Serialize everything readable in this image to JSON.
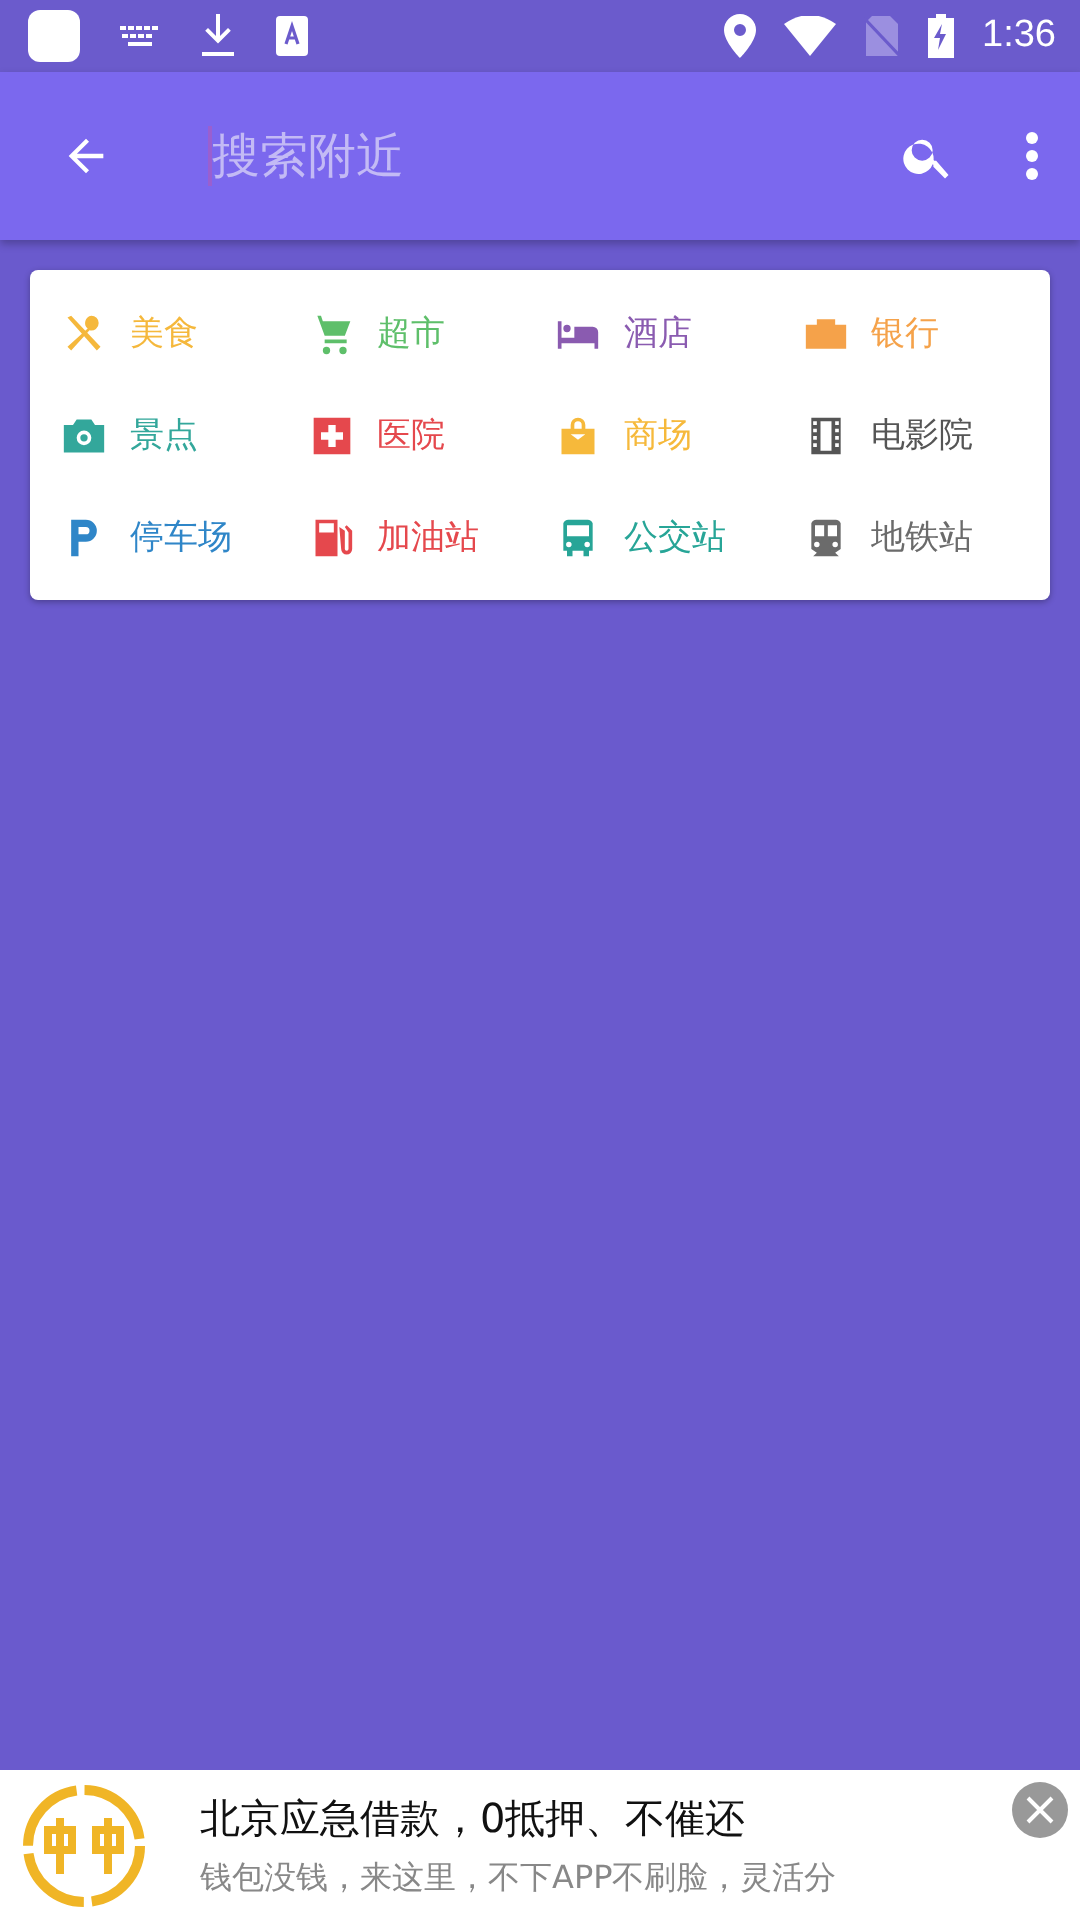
{
  "status_bar": {
    "time": "1:36"
  },
  "toolbar": {
    "search": {
      "placeholder": "搜索附近"
    }
  },
  "categories": [
    {
      "kind": "food",
      "label": "美食",
      "color": "#f5b83c"
    },
    {
      "kind": "cart",
      "label": "超市",
      "color": "#5ebf6a"
    },
    {
      "kind": "bed",
      "label": "酒店",
      "color": "#8a5bb0"
    },
    {
      "kind": "bank",
      "label": "银行",
      "color": "#f5a24a"
    },
    {
      "kind": "camera",
      "label": "景点",
      "color": "#33a79b"
    },
    {
      "kind": "hospital",
      "label": "医院",
      "color": "#e5484d"
    },
    {
      "kind": "bag",
      "label": "商场",
      "color": "#f6b93b"
    },
    {
      "kind": "film",
      "label": "电影院",
      "color": "#555555"
    },
    {
      "kind": "parking",
      "label": "停车场",
      "color": "#2f86c8"
    },
    {
      "kind": "fuel",
      "label": "加油站",
      "color": "#e5484d"
    },
    {
      "kind": "bus",
      "label": "公交站",
      "color": "#27a597"
    },
    {
      "kind": "subway",
      "label": "地铁站",
      "color": "#6b6b6b"
    }
  ],
  "ad": {
    "title": "北京应急借款，0抵押、不催还",
    "subtitle": "钱包没钱，来这里，不下APP不刷脸，灵活分"
  }
}
